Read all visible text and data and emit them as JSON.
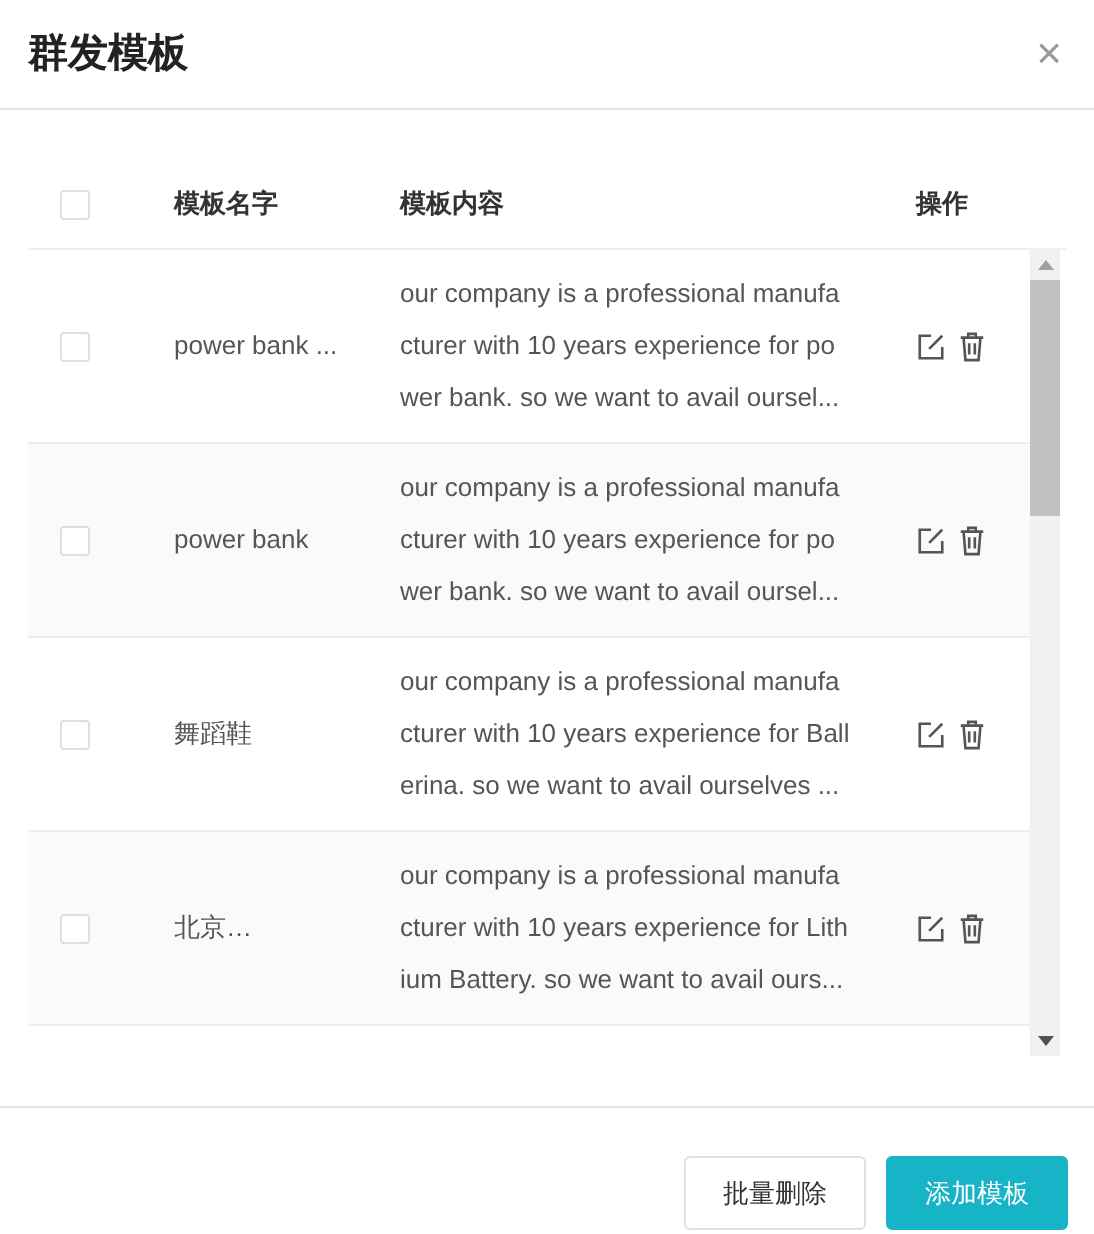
{
  "dialog": {
    "title": "群发模板",
    "close": "×"
  },
  "table": {
    "select_all_checked": false,
    "columns": [
      "模板名字",
      "模板内容",
      "操作"
    ],
    "rows": [
      {
        "checked": false,
        "name": "power bank ...",
        "content": [
          "our company is a professional manufa",
          "cturer with 10 years experience for po",
          "wer bank. so we want to avail oursel..."
        ]
      },
      {
        "checked": false,
        "name": "power bank",
        "content": [
          "our company is a professional manufa",
          "cturer with 10 years experience for po",
          "wer bank. so we want to avail oursel..."
        ]
      },
      {
        "checked": false,
        "name": "舞蹈鞋",
        "content": [
          "our company is a professional manufa",
          "cturer with 10 years experience for Ball",
          "erina. so we want to avail ourselves ..."
        ]
      },
      {
        "checked": false,
        "name": "北京…",
        "content": [
          "our company is a professional manufa",
          "cturer with 10 years experience for Lith",
          "ium Battery. so we want to avail ours..."
        ]
      }
    ]
  },
  "buttons": [
    {
      "label": "批量删除",
      "kind": "secondary"
    },
    {
      "label": "添加模板",
      "kind": "primary"
    }
  ]
}
